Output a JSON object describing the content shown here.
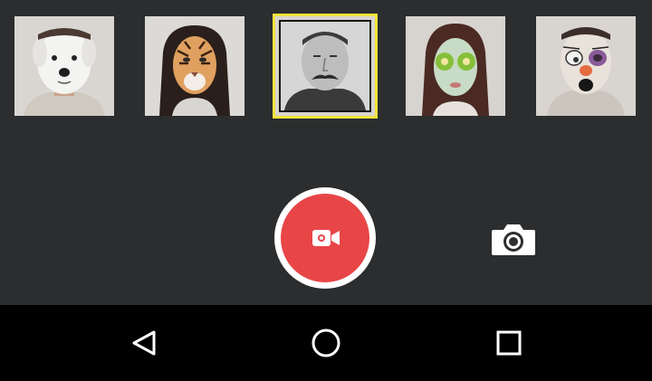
{
  "filters": [
    {
      "name": "dog-mask",
      "selected": false
    },
    {
      "name": "tiger-mask",
      "selected": false
    },
    {
      "name": "mustache-man",
      "selected": true
    },
    {
      "name": "kiwi-eyes-mask",
      "selected": false
    },
    {
      "name": "clown-face",
      "selected": false
    }
  ],
  "controls": {
    "record_icon": "video-camera-icon",
    "photo_icon": "camera-icon",
    "record_color": "#e84547",
    "selected_color": "#f3e33a"
  },
  "navbar": {
    "back_icon": "back-triangle-icon",
    "home_icon": "home-circle-icon",
    "recents_icon": "recents-square-icon"
  }
}
